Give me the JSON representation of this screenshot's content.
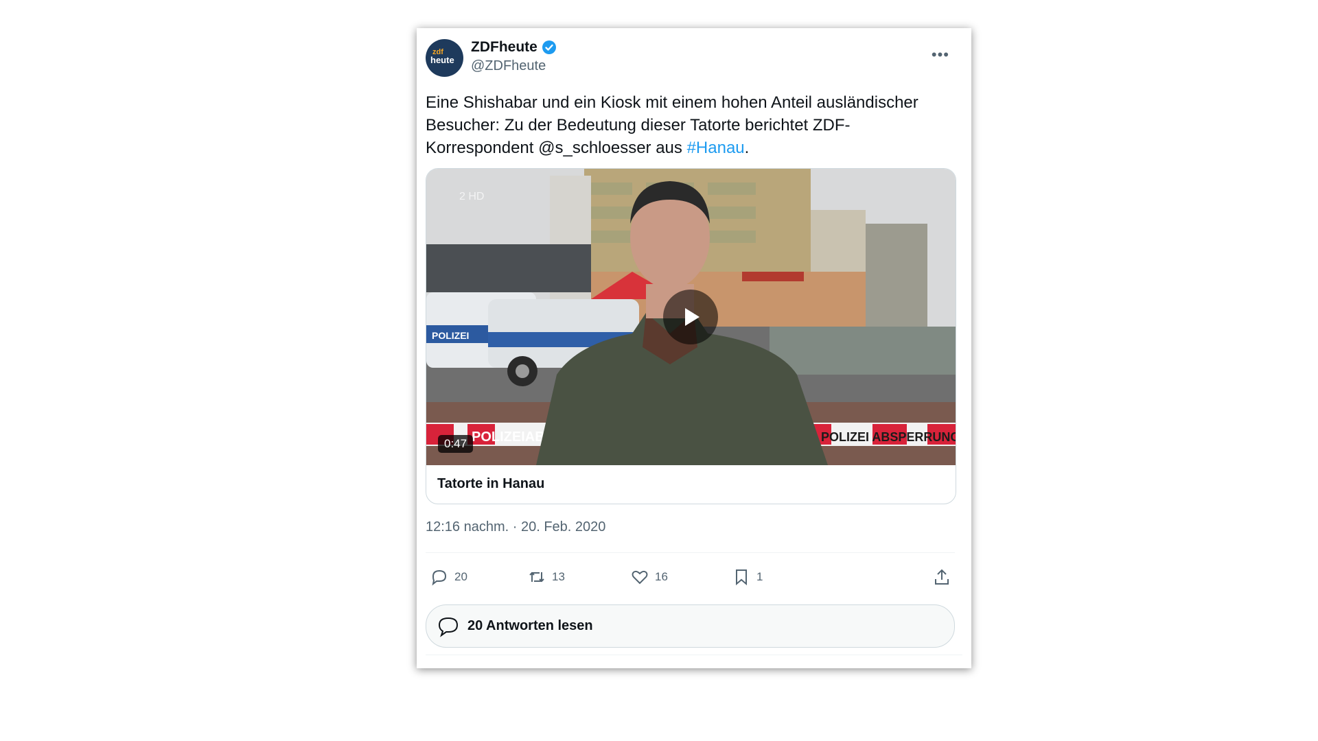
{
  "account": {
    "display_name": "ZDFheute",
    "handle": "@ZDFheute",
    "avatar_text_top": "zdf",
    "avatar_text_bottom": "heute",
    "verified": true,
    "more_icon": "ellipsis-icon"
  },
  "tweet": {
    "text_part1": "Eine Shishabar und ein Kiosk mit einem hohen Anteil ausländischer Besucher: Zu der Bedeutung dieser Tatorte berichtet ZDF-Korrespondent @s_schloesser aus ",
    "hashtag": "#Hanau",
    "text_part2": "."
  },
  "media": {
    "duration": "0:47",
    "title": "Tatorte in Hanau",
    "scene_text_left_tape": "POLIZEIABSPERRUNG",
    "scene_text_right_tape": "POLIZEI ABSPERRUNG",
    "van_label": "POLIZEI"
  },
  "timestamp": "12:16 nachm. · 20. Feb. 2020",
  "actions": {
    "reply_count": "20",
    "retweet_count": "13",
    "like_count": "16",
    "bookmark_count": "1"
  },
  "read_replies_label": "20 Antworten lesen",
  "colors": {
    "link": "#1d9bf0",
    "text": "#0f1419",
    "secondary": "#536471",
    "border": "#cfd9de"
  }
}
